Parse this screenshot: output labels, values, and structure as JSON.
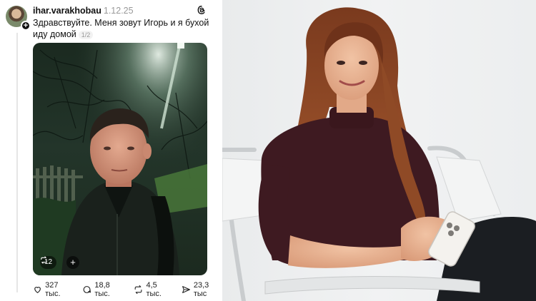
{
  "post": {
    "username": "ihar.varakhobau",
    "timestamp": "1.12.25",
    "text": "Здравствуйте. Меня зовут Игорь и я бухой иду домой",
    "page_indicator": "1/2",
    "media_badges": {
      "reposts": "12"
    },
    "actions": {
      "likes": "327 тыс.",
      "comments": "18,8 тыс.",
      "reposts": "4,5 тыс.",
      "shares": "23,3 тыс"
    }
  },
  "icons": {
    "avatar_plus": "plus-icon",
    "threads": "threads-logo-icon",
    "like": "heart-icon",
    "comment": "comment-icon",
    "repost": "repost-icon",
    "share": "send-icon"
  },
  "colors": {
    "text": "#111111",
    "muted": "#999999",
    "thread_line": "#e6e6e6"
  }
}
